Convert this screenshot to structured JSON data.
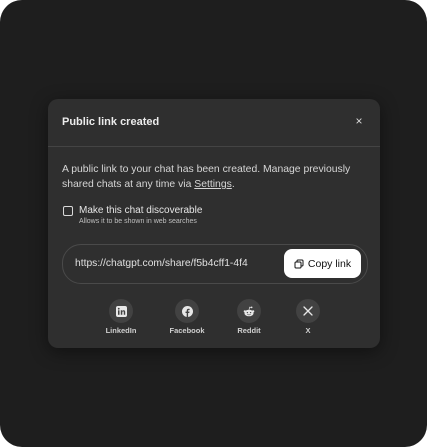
{
  "dialog": {
    "title": "Public link created",
    "close_glyph": "×",
    "description_prefix": "A public link to your chat has been created. Manage previously shared chats at any time via ",
    "settings_link": "Settings",
    "description_suffix": "."
  },
  "discoverable": {
    "label": "Make this chat discoverable",
    "sublabel": "Allows it to be shown in web searches",
    "checked": false
  },
  "link": {
    "url": "https://chatgpt.com/share/f5b4cff1-4f4",
    "copy_label": "Copy link"
  },
  "share": [
    {
      "label": "LinkedIn",
      "icon": "linkedin-icon"
    },
    {
      "label": "Facebook",
      "icon": "facebook-icon"
    },
    {
      "label": "Reddit",
      "icon": "reddit-icon"
    },
    {
      "label": "X",
      "icon": "x-icon"
    }
  ],
  "colors": {
    "background": "#1e1e1e",
    "modal": "#2f2f2f",
    "copy_button": "#ffffff"
  }
}
